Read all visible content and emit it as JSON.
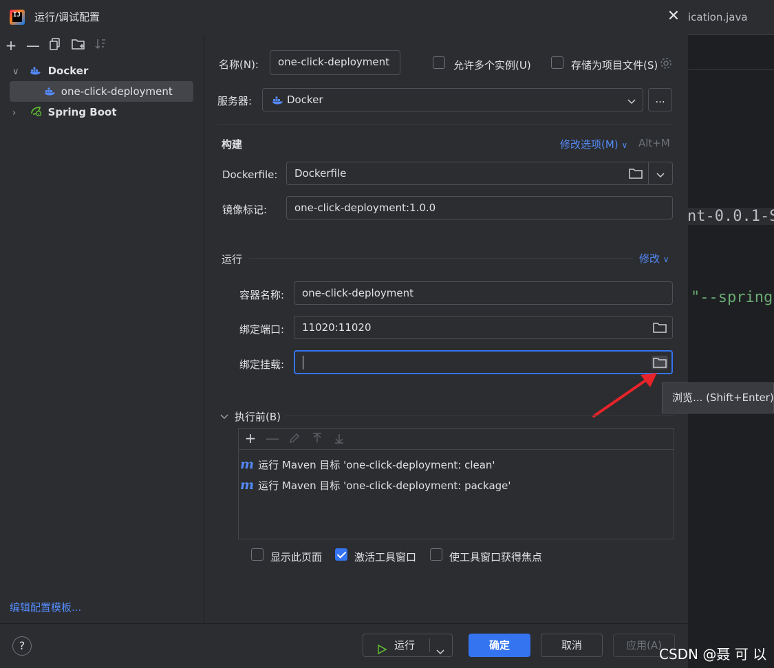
{
  "window": {
    "title": "运行/调试配置"
  },
  "editor": {
    "tab_label": "ication.java",
    "code_line_1": "nt-0.0.1-S",
    "code_line_2": "\"--spring"
  },
  "sidebar": {
    "tree": [
      {
        "label": "Docker",
        "expanded": true,
        "icon": "docker-icon"
      },
      {
        "label": "one-click-deployment",
        "selected": true,
        "icon": "docker-icon"
      },
      {
        "label": "Spring Boot",
        "expanded": false,
        "icon": "spring-boot-icon"
      }
    ],
    "edit_templates_link": "编辑配置模板..."
  },
  "form": {
    "name_label": "名称(N):",
    "name_value": "one-click-deployment",
    "allow_multiple_label": "允许多个实例(U)",
    "store_as_file_label": "存储为项目文件(S)",
    "server_label": "服务器:",
    "server_value": "Docker",
    "more_button": "...",
    "build": {
      "title": "构建",
      "modify_options": "修改选项(M)",
      "shortcut": "Alt+M",
      "dockerfile_label": "Dockerfile:",
      "dockerfile_value": "Dockerfile",
      "image_tag_label": "镜像标记:",
      "image_tag_value": "one-click-deployment:1.0.0"
    },
    "run": {
      "title": "运行",
      "modify": "修改",
      "container_name_label": "容器名称:",
      "container_name_value": "one-click-deployment",
      "bind_ports_label": "绑定端口:",
      "bind_ports_value": "11020:11020",
      "bind_mounts_label": "绑定挂载:",
      "bind_mounts_value": ""
    },
    "tooltip": "浏览... (Shift+Enter)",
    "before_launch": {
      "title": "执行前(B)",
      "tasks": [
        "运行 Maven 目标 'one-click-deployment: clean'",
        "运行 Maven 目标 'one-click-deployment: package'"
      ],
      "show_page_label": "显示此页面",
      "show_page_checked": false,
      "activate_tool_window_label": "激活工具窗口",
      "activate_tool_window_checked": true,
      "focus_tool_window_label": "使工具窗口获得焦点",
      "focus_tool_window_checked": false
    }
  },
  "footer": {
    "help": "?",
    "run_button": "运行",
    "ok_button": "确定",
    "cancel_button": "取消",
    "apply_button": "应用(A)"
  },
  "watermark": "CSDN @聂 可 以",
  "colors": {
    "accent": "#3574f0",
    "link": "#548af7",
    "background": "#2b2d30",
    "arrow": "#e8242a"
  }
}
